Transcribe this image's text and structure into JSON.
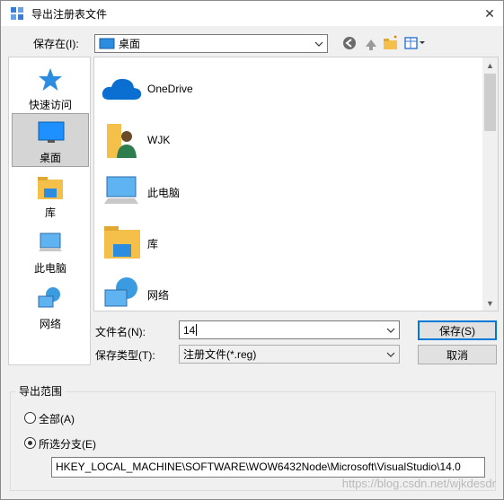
{
  "window": {
    "title": "导出注册表文件",
    "close_glyph": "✕"
  },
  "look_in": {
    "label": "保存在(I):",
    "value": "桌面"
  },
  "places": [
    {
      "label": "快速访问",
      "icon": "star-icon"
    },
    {
      "label": "桌面",
      "icon": "desktop-icon",
      "selected": true
    },
    {
      "label": "库",
      "icon": "library-icon"
    },
    {
      "label": "此电脑",
      "icon": "computer-icon"
    },
    {
      "label": "网络",
      "icon": "network-icon"
    }
  ],
  "files": [
    {
      "name": "OneDrive",
      "icon": "cloud-icon"
    },
    {
      "name": "WJK",
      "icon": "user-folder-icon"
    },
    {
      "name": "此电脑",
      "icon": "computer-icon"
    },
    {
      "name": "库",
      "icon": "library-icon"
    },
    {
      "name": "网络",
      "icon": "network-icon"
    }
  ],
  "filename": {
    "label": "文件名(N):",
    "value": "14"
  },
  "filetype": {
    "label": "保存类型(T):",
    "value": "注册文件(*.reg)"
  },
  "buttons": {
    "save": "保存(S)",
    "cancel": "取消"
  },
  "export_range": {
    "title": "导出范围",
    "all_label": "全部(A)",
    "branch_label": "所选分支(E)",
    "selected": "branch",
    "path": "HKEY_LOCAL_MACHINE\\SOFTWARE\\WOW6432Node\\Microsoft\\VisualStudio\\14.0"
  },
  "watermark": "https://blog.csdn.net/wjkdesdr",
  "colors": {
    "accent": "#0078d7",
    "folder": "#f4c04a"
  }
}
